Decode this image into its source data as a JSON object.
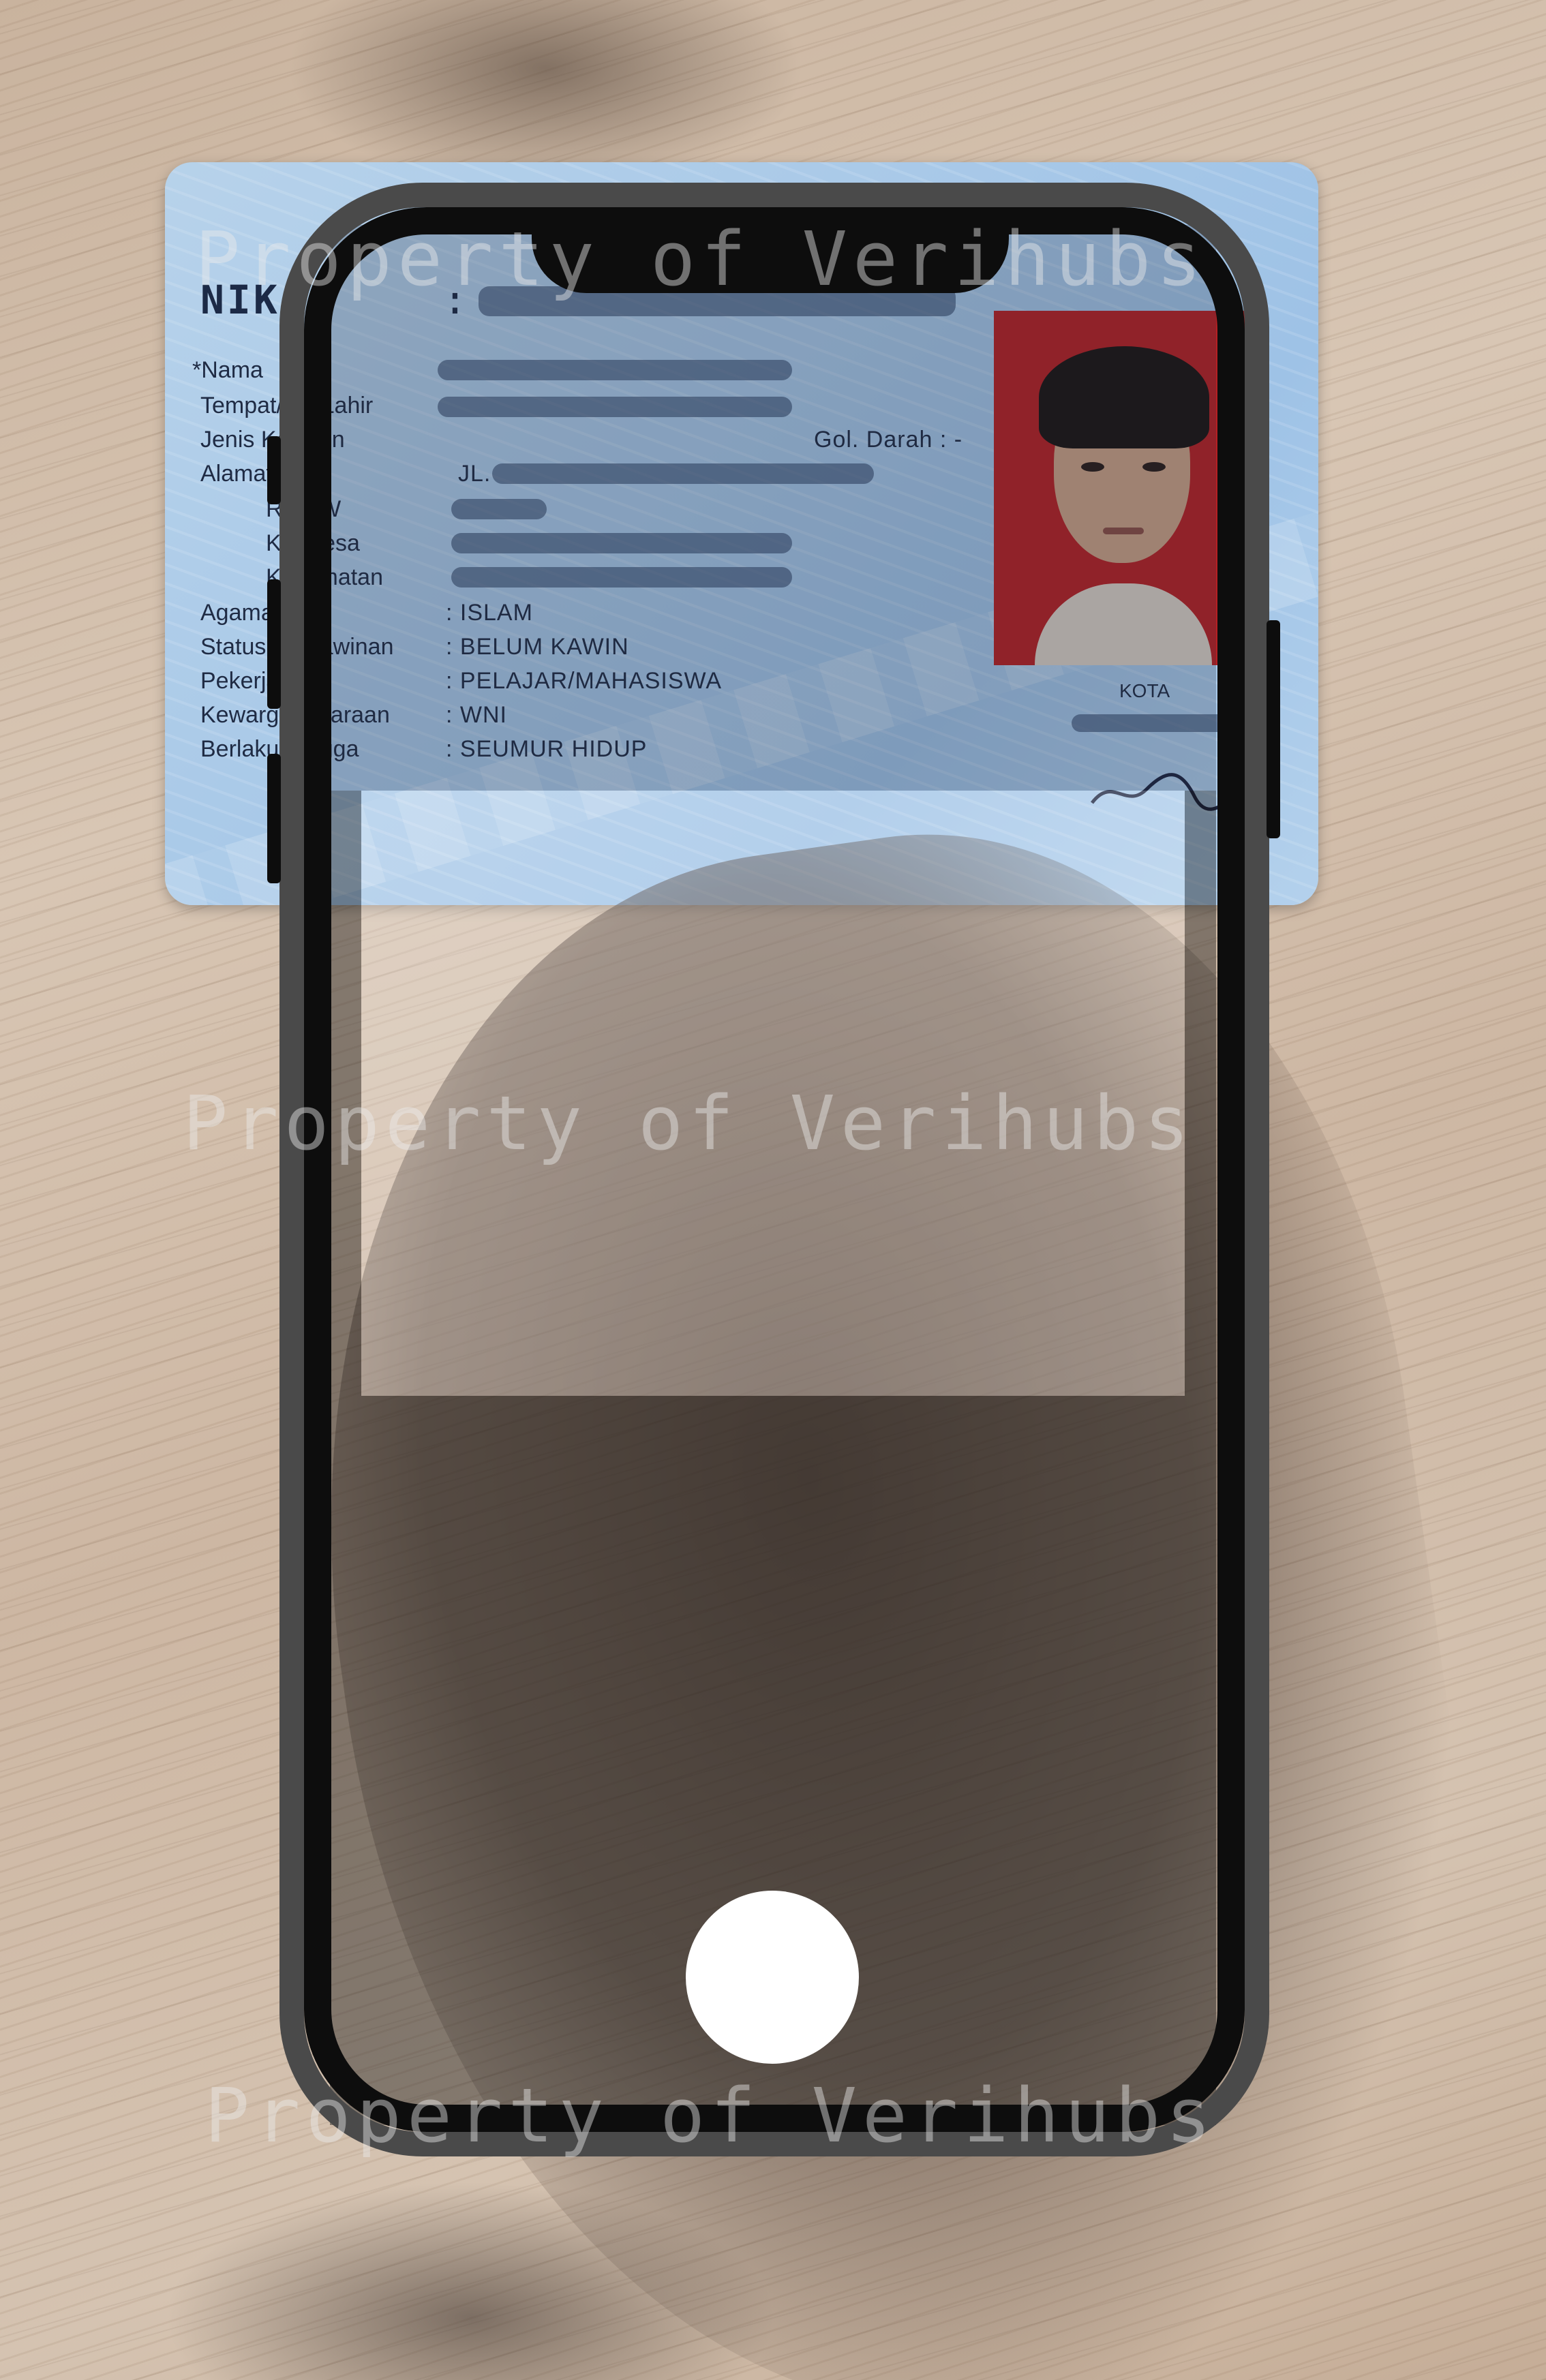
{
  "watermark": {
    "top": "Property of Verihubs",
    "middle": "Property of Verihubs",
    "bottom": "Property of Verihubs"
  },
  "id_card": {
    "nik_label": "NIK",
    "nik_separator": ":",
    "fields": [
      {
        "label": "*Nama",
        "value": ""
      },
      {
        "label": "Tempat/Tgl Lahir",
        "value": ""
      },
      {
        "label": "Jenis Kelamin",
        "value": "Gol. Darah  :  -"
      },
      {
        "label": "Alamat",
        "value": "JL."
      },
      {
        "label": "RT/RW",
        "value": ""
      },
      {
        "label": "Kel/Desa",
        "value": ""
      },
      {
        "label": "Kecamatan",
        "value": ""
      },
      {
        "label": "Agama",
        "value": ": ISLAM"
      },
      {
        "label": "Status Perkawinan",
        "value": ": BELUM KAWIN"
      },
      {
        "label": "Pekerjaan",
        "value": ": PELAJAR/MAHASISWA"
      },
      {
        "label": "Kewarganegaraan",
        "value": ": WNI"
      },
      {
        "label": "Berlaku Hingga",
        "value": ": SEUMUR HIDUP"
      }
    ],
    "kota_label": "KOTA"
  },
  "camera": {
    "shutter_icon": "shutter-circle-icon"
  },
  "colors": {
    "phone_frame": "#4a4a4a",
    "phone_bezel": "#0d0d0d",
    "shutter": "#ffffff",
    "card_blue": "#a9c9e8",
    "photo_bg": "#b62023"
  }
}
